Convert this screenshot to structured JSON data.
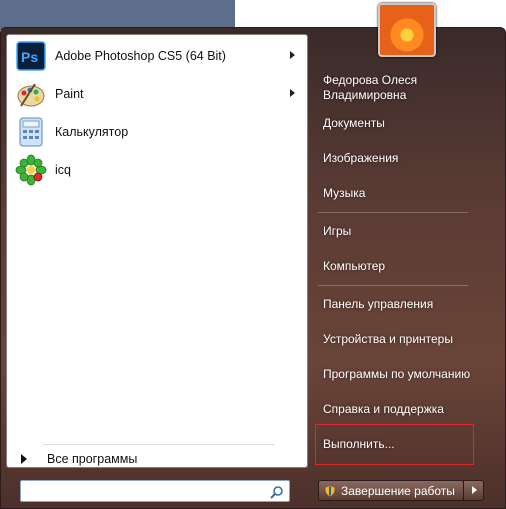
{
  "programs": [
    {
      "name": "Adobe Photoshop CS5 (64 Bit)",
      "icon": "photoshop-icon",
      "has_arrow": true
    },
    {
      "name": "Paint",
      "icon": "paint-icon",
      "has_arrow": true
    },
    {
      "name": "Калькулятор",
      "icon": "calculator-icon",
      "has_arrow": false
    },
    {
      "name": "icq",
      "icon": "icq-icon",
      "has_arrow": false
    }
  ],
  "all_programs": "Все программы",
  "search": {
    "placeholder": "",
    "value": ""
  },
  "user": {
    "name_line1": "Федорова Олеся",
    "name_line2": "Владимировна"
  },
  "right_items": [
    "Документы",
    "Изображения",
    "Музыка",
    "Игры",
    "Компьютер",
    "Панель управления",
    "Устройства и принтеры",
    "Программы по умолчанию",
    "Справка и поддержка",
    "Выполнить..."
  ],
  "shutdown_label": "Завершение работы",
  "colors": {
    "accent_highlight": "#e0282a",
    "menu_bg": "#5a3b34"
  }
}
